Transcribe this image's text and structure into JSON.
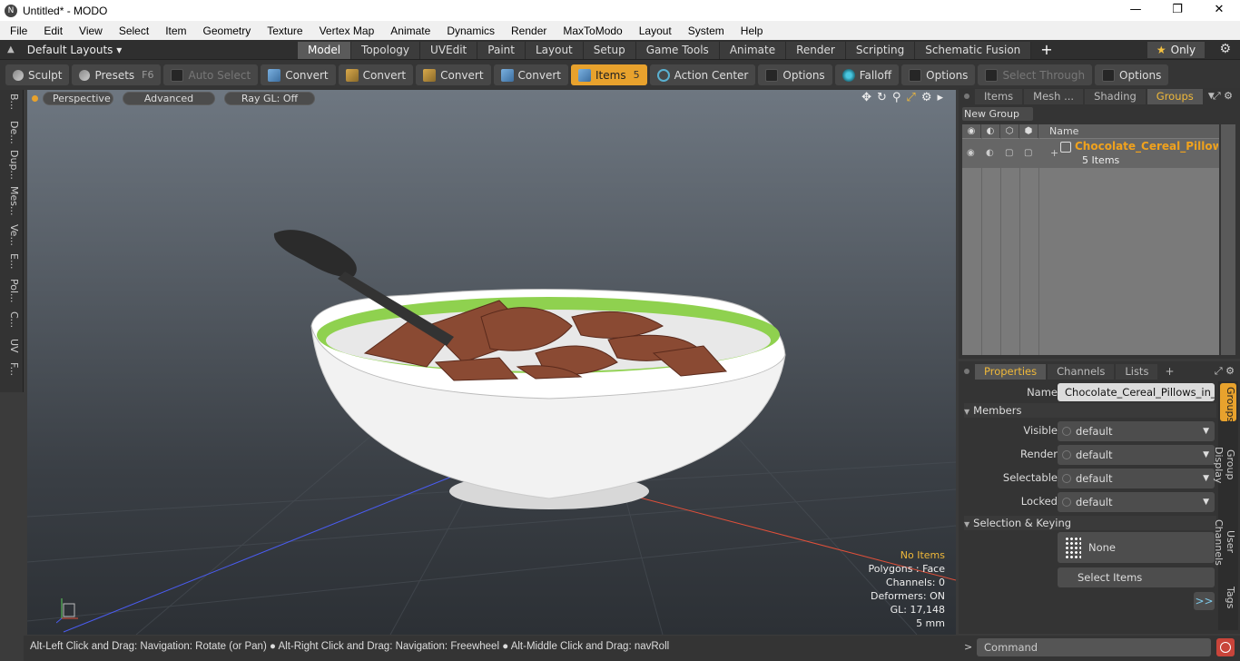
{
  "window": {
    "title": "Untitled* - MODO",
    "app_icon": "N",
    "controls": {
      "minimize": "—",
      "maximize": "❐",
      "close": "✕"
    }
  },
  "menu": [
    "File",
    "Edit",
    "View",
    "Select",
    "Item",
    "Geometry",
    "Texture",
    "Vertex Map",
    "Animate",
    "Dynamics",
    "Render",
    "MaxToModo",
    "Layout",
    "System",
    "Help"
  ],
  "layoutbar": {
    "layout": "Default Layouts ▾",
    "tabs": [
      "Model",
      "Topology",
      "UVEdit",
      "Paint",
      "Layout",
      "Setup",
      "Game Tools",
      "Animate",
      "Render",
      "Scripting",
      "Schematic Fusion"
    ],
    "active_tab": "Model",
    "plus": "+",
    "only_label": "Only",
    "star": "★"
  },
  "toolbar": {
    "sculpt": "Sculpt",
    "presets": "Presets",
    "presets_key": "F6",
    "auto_select": "Auto Select",
    "convert1": "Convert",
    "convert2": "Convert",
    "convert3": "Convert",
    "convert4": "Convert",
    "items": "Items",
    "items_key": "5",
    "action_center": "Action Center",
    "options1": "Options",
    "falloff": "Falloff",
    "options2": "Options",
    "select_through": "Select Through",
    "options3": "Options"
  },
  "leftstrip": [
    "B...",
    "De...",
    "Dup...",
    "Mes...",
    "Ve...",
    "E...",
    "Pol...",
    "C...",
    "UV",
    "F..."
  ],
  "viewport": {
    "perspective": "Perspective",
    "advanced": "Advanced",
    "raygl": "Ray GL: Off",
    "info": {
      "items": "No Items",
      "polygons": "Polygons : Face",
      "channels": "Channels: 0",
      "deformers": "Deformers: ON",
      "gl": "GL: 17,148",
      "unit": "5 mm"
    }
  },
  "statusbar": "Alt-Left Click and Drag: Navigation: Rotate (or Pan) ● Alt-Right Click and Drag: Navigation: Freewheel ● Alt-Middle Click and Drag: navRoll",
  "groups_panel": {
    "tabs": [
      "Items",
      "Mesh ...",
      "Shading",
      "Groups"
    ],
    "active_tab": "Groups",
    "new_group": "New Group",
    "column_name": "Name",
    "row": {
      "name": "Chocolate_Cereal_Pillows ...",
      "count": "5 Items"
    }
  },
  "properties_panel": {
    "tabs": [
      "Properties",
      "Channels",
      "Lists"
    ],
    "active_tab": "Properties",
    "plus": "+",
    "name_label": "Name",
    "name_value": "Chocolate_Cereal_Pillows_in_Bowl",
    "members_section": "Members",
    "visible_label": "Visible",
    "visible_value": "default",
    "render_label": "Render",
    "render_value": "default",
    "selectable_label": "Selectable",
    "selectable_value": "default",
    "locked_label": "Locked",
    "locked_value": "default",
    "selection_section": "Selection & Keying",
    "none_label": "None",
    "select_items": "Select Items",
    "more": ">>",
    "side_tabs": [
      "Groups",
      "Group Display",
      "User Channels",
      "Tags"
    ]
  },
  "command": {
    "placeholder": "Command",
    "prompt": ">"
  }
}
